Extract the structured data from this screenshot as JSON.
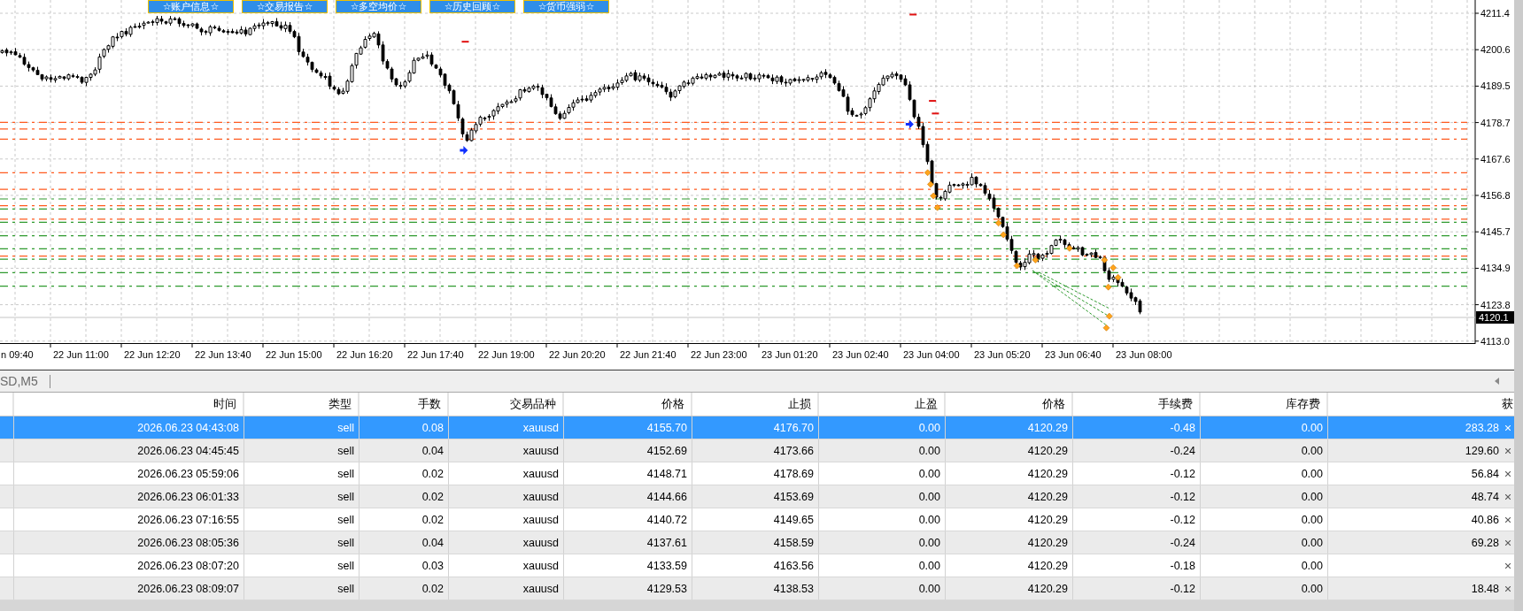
{
  "toolbar": {
    "buttons": [
      {
        "label": "☆账户信息☆"
      },
      {
        "label": "☆交易报告☆"
      },
      {
        "label": "☆多空均价☆"
      },
      {
        "label": "☆历史回顾☆"
      },
      {
        "label": "☆货币强弱☆"
      }
    ]
  },
  "chart": {
    "price_labels": [
      "4211.4",
      "4200.6",
      "4189.5",
      "4178.7",
      "4167.6",
      "4156.8",
      "4145.7",
      "4134.9",
      "4123.8",
      "4113.0"
    ],
    "current_price": "4120.1",
    "time_labels": [
      "n 09:40",
      "22 Jun 11:00",
      "22 Jun 12:20",
      "22 Jun 13:40",
      "22 Jun 15:00",
      "22 Jun 16:20",
      "22 Jun 17:40",
      "22 Jun 19:00",
      "22 Jun 20:20",
      "22 Jun 21:40",
      "22 Jun 23:00",
      "23 Jun 01:20",
      "23 Jun 02:40",
      "23 Jun 04:00",
      "23 Jun 05:20",
      "23 Jun 06:40",
      "23 Jun 08:00"
    ]
  },
  "tab_bar": {
    "title": "SD,M5"
  },
  "table": {
    "columns": [
      "时间",
      "类型",
      "手数",
      "交易品种",
      "价格",
      "止损",
      "止盈",
      "价格",
      "手续费",
      "库存费",
      "获"
    ],
    "rows": [
      {
        "selected": true,
        "cells": [
          "2026.06.23 04:43:08",
          "sell",
          "0.08",
          "xauusd",
          "4155.70",
          "4176.70",
          "0.00",
          "4120.29",
          "-0.48",
          "0.00",
          "283.28"
        ]
      },
      {
        "selected": false,
        "cells": [
          "2026.06.23 04:45:45",
          "sell",
          "0.04",
          "xauusd",
          "4152.69",
          "4173.66",
          "0.00",
          "4120.29",
          "-0.24",
          "0.00",
          "129.60"
        ]
      },
      {
        "selected": false,
        "cells": [
          "2026.06.23 05:59:06",
          "sell",
          "0.02",
          "xauusd",
          "4148.71",
          "4178.69",
          "0.00",
          "4120.29",
          "-0.12",
          "0.00",
          "56.84"
        ]
      },
      {
        "selected": false,
        "cells": [
          "2026.06.23 06:01:33",
          "sell",
          "0.02",
          "xauusd",
          "4144.66",
          "4153.69",
          "0.00",
          "4120.29",
          "-0.12",
          "0.00",
          "48.74"
        ]
      },
      {
        "selected": false,
        "cells": [
          "2026.06.23 07:16:55",
          "sell",
          "0.02",
          "xauusd",
          "4140.72",
          "4149.65",
          "0.00",
          "4120.29",
          "-0.12",
          "0.00",
          "40.86"
        ]
      },
      {
        "selected": false,
        "cells": [
          "2026.06.23 08:05:36",
          "sell",
          "0.04",
          "xauusd",
          "4137.61",
          "4158.59",
          "0.00",
          "4120.29",
          "-0.24",
          "0.00",
          "69.28"
        ]
      },
      {
        "selected": false,
        "cells": [
          "2026.06.23 08:07:20",
          "sell",
          "0.03",
          "xauusd",
          "4133.59",
          "4163.56",
          "0.00",
          "4120.29",
          "-0.18",
          "0.00"
        ]
      },
      {
        "selected": false,
        "cells": [
          "2026.06.23 08:09:07",
          "sell",
          "0.02",
          "xauusd",
          "4129.53",
          "4138.53",
          "0.00",
          "4120.29",
          "-0.12",
          "0.00",
          "18.48"
        ]
      }
    ]
  }
}
